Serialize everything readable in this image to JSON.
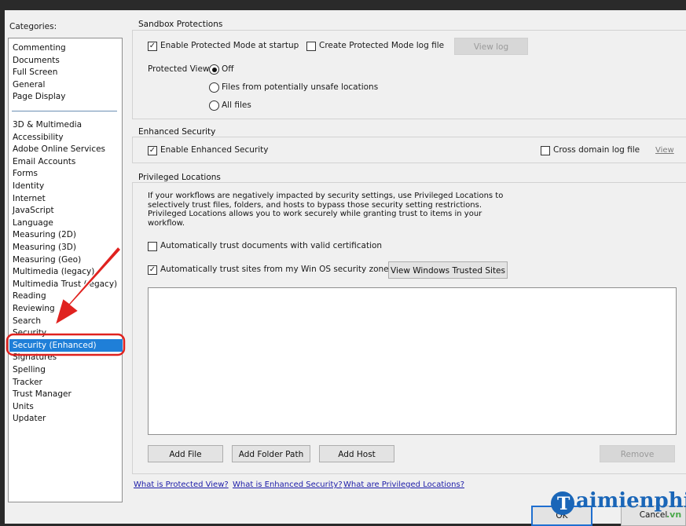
{
  "categories_label": "Categories:",
  "categories": {
    "group1": [
      "Commenting",
      "Documents",
      "Full Screen",
      "General",
      "Page Display"
    ],
    "group2": [
      "3D & Multimedia",
      "Accessibility",
      "Adobe Online Services",
      "Email Accounts",
      "Forms",
      "Identity",
      "Internet",
      "JavaScript",
      "Language",
      "Measuring (2D)",
      "Measuring (3D)",
      "Measuring (Geo)",
      "Multimedia (legacy)",
      "Multimedia Trust (legacy)",
      "Reading",
      "Reviewing",
      "Search",
      "Security",
      "Security (Enhanced)",
      "Signatures",
      "Spelling",
      "Tracker",
      "Trust Manager",
      "Units",
      "Updater"
    ],
    "selected": "Security (Enhanced)"
  },
  "sandbox": {
    "title": "Sandbox Protections",
    "enable_protected_mode": {
      "label": "Enable Protected Mode at startup",
      "checked": true
    },
    "create_log": {
      "label": "Create Protected Mode log file",
      "checked": false
    },
    "view_log": "View log",
    "protected_view_label": "Protected View",
    "options": [
      "Off",
      "Files from potentially unsafe locations",
      "All files"
    ],
    "selected_option": "Off"
  },
  "enhanced": {
    "title": "Enhanced Security",
    "enable": {
      "label": "Enable Enhanced Security",
      "checked": true
    },
    "cross_domain": {
      "label": "Cross domain log file",
      "checked": false
    },
    "view": "View"
  },
  "privileged": {
    "title": "Privileged Locations",
    "description": [
      "If your workflows are negatively impacted by security settings, use Privileged Locations to",
      "selectively trust files, folders, and hosts to bypass those security setting restrictions.",
      "Privileged Locations allows you to work securely while granting trust to items in your",
      "workflow."
    ],
    "trust_certified": {
      "label": "Automatically trust documents with valid certification",
      "checked": false
    },
    "trust_win_zones": {
      "label": "Automatically trust sites from my Win OS security zones",
      "checked": true
    },
    "view_trusted_sites": "View Windows Trusted Sites",
    "add_file": "Add File",
    "add_folder": "Add Folder Path",
    "add_host": "Add Host",
    "remove": "Remove"
  },
  "links": {
    "protected_view": "What is Protected View?",
    "enhanced_security": "What is Enhanced Security?",
    "privileged_locations": "What are Privileged Locations?"
  },
  "footer": {
    "ok": "OK",
    "cancel": "Cancel"
  },
  "watermark": {
    "text": "aimienphi",
    "suffix": ".vn"
  },
  "colors": {
    "selection": "#1f7fd8",
    "annotation_red": "#e0221f",
    "link": "#1b1ba8"
  }
}
